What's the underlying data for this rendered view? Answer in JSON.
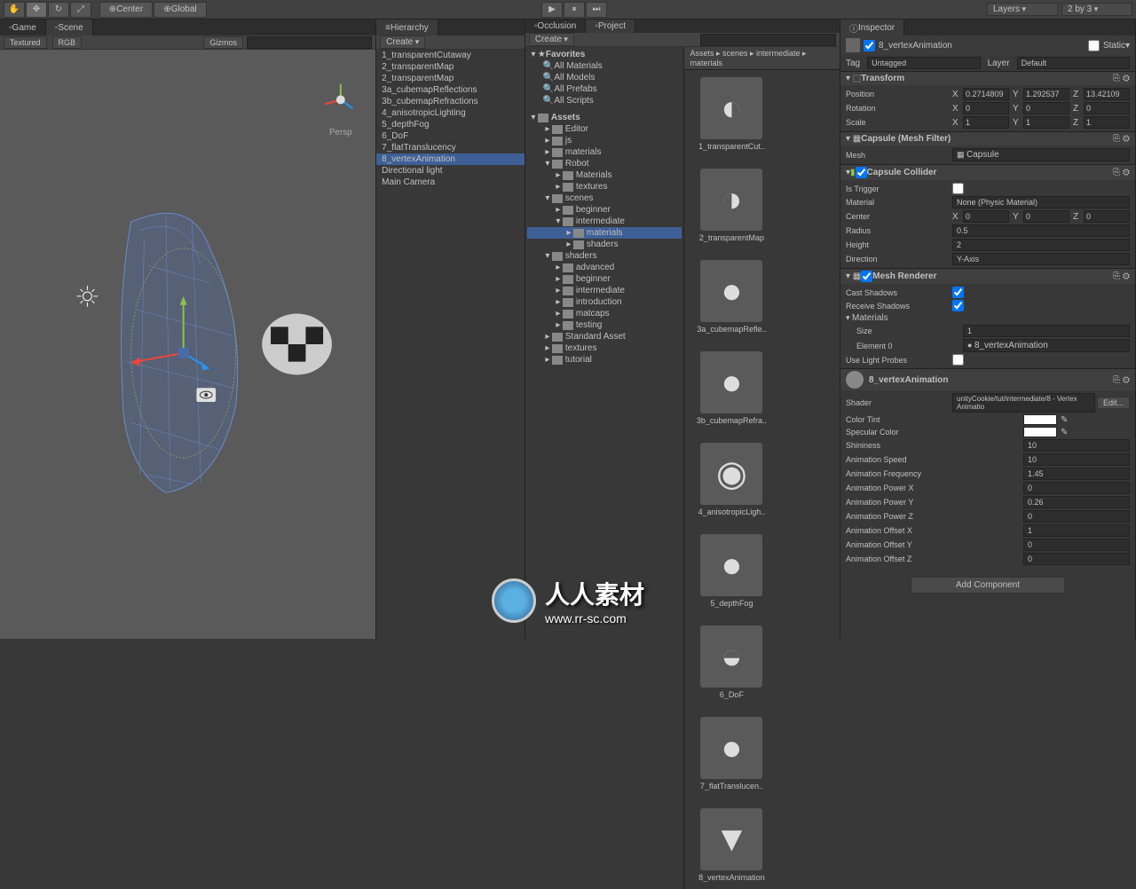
{
  "toolbar": {
    "center": "Center",
    "global": "Global",
    "layers": "Layers",
    "layout": "2 by 3"
  },
  "scene": {
    "tab_game": "Game",
    "tab_scene": "Scene",
    "mode": "Textured",
    "rgb": "RGB",
    "gizmos": "Gizmos",
    "persp": "Persp"
  },
  "hierarchy": {
    "title": "Hierarchy",
    "create": "Create",
    "items": [
      "1_transparentCutaway",
      "2_transparentMap",
      "2_transparentMap",
      "3a_cubemapReflections",
      "3b_cubemapRefractions",
      "4_anisotropicLighting",
      "5_depthFog",
      "6_DoF",
      "7_flatTranslucency",
      "8_vertexAnimation",
      "Directional light",
      "Main Camera"
    ],
    "selected_index": 9
  },
  "project": {
    "tab_occlusion": "Occlusion",
    "tab_project": "Project",
    "create": "Create",
    "favorites": {
      "label": "Favorites",
      "items": [
        "All Materials",
        "All Models",
        "All Prefabs",
        "All Scripts"
      ]
    },
    "assets": {
      "label": "Assets",
      "tree": [
        {
          "name": "Editor",
          "depth": 1
        },
        {
          "name": "js",
          "depth": 1
        },
        {
          "name": "materials",
          "depth": 1
        },
        {
          "name": "Robot",
          "depth": 1,
          "open": true
        },
        {
          "name": "Materials",
          "depth": 2
        },
        {
          "name": "textures",
          "depth": 2
        },
        {
          "name": "scenes",
          "depth": 1,
          "open": true
        },
        {
          "name": "beginner",
          "depth": 2
        },
        {
          "name": "intermediate",
          "depth": 2,
          "open": true
        },
        {
          "name": "materials",
          "depth": 3,
          "selected": true
        },
        {
          "name": "shaders",
          "depth": 3
        },
        {
          "name": "shaders",
          "depth": 1,
          "open": true
        },
        {
          "name": "advanced",
          "depth": 2
        },
        {
          "name": "beginner",
          "depth": 2
        },
        {
          "name": "intermediate",
          "depth": 2
        },
        {
          "name": "introduction",
          "depth": 2
        },
        {
          "name": "matcaps",
          "depth": 2
        },
        {
          "name": "testing",
          "depth": 2
        },
        {
          "name": "Standard Asset",
          "depth": 1
        },
        {
          "name": "textures",
          "depth": 1
        },
        {
          "name": "tutorial",
          "depth": 1
        }
      ]
    },
    "breadcrumb": [
      "Assets",
      "scenes",
      "intermediate",
      "materials"
    ],
    "grid": [
      "1_transparentCut..",
      "2_transparentMap",
      "3a_cubemapRefle..",
      "3b_cubemapRefra..",
      "4_anisotropicLigh..",
      "5_depthFog",
      "6_DoF",
      "7_flatTranslucen..",
      "8_vertexAnimation"
    ]
  },
  "inspector": {
    "title": "Inspector",
    "object_name": "8_vertexAnimation",
    "static": "Static",
    "tag_label": "Tag",
    "tag_value": "Untagged",
    "layer_label": "Layer",
    "layer_value": "Default",
    "transform": {
      "title": "Transform",
      "position": {
        "label": "Position",
        "x": "0.2714809",
        "y": "1.292537",
        "z": "13.42109"
      },
      "rotation": {
        "label": "Rotation",
        "x": "0",
        "y": "0",
        "z": "0"
      },
      "scale": {
        "label": "Scale",
        "x": "1",
        "y": "1",
        "z": "1"
      }
    },
    "mesh_filter": {
      "title": "Capsule (Mesh Filter)",
      "mesh_label": "Mesh",
      "mesh_value": "Capsule"
    },
    "collider": {
      "title": "Capsule Collider",
      "is_trigger": "Is Trigger",
      "material_label": "Material",
      "material_value": "None (Physic Material)",
      "center": {
        "label": "Center",
        "x": "0",
        "y": "0",
        "z": "0"
      },
      "radius_label": "Radius",
      "radius_value": "0.5",
      "height_label": "Height",
      "height_value": "2",
      "direction_label": "Direction",
      "direction_value": "Y-Axis"
    },
    "renderer": {
      "title": "Mesh Renderer",
      "cast_shadows": "Cast Shadows",
      "receive_shadows": "Receive Shadows",
      "materials": "Materials",
      "size_label": "Size",
      "size_value": "1",
      "element_label": "Element 0",
      "element_value": "8_vertexAnimation",
      "use_light_probes": "Use Light Probes"
    },
    "material": {
      "name": "8_vertexAnimation",
      "shader_label": "Shader",
      "shader_value": "unityCookie/tut/intermediate/8 - Vertex Animatio",
      "edit": "Edit...",
      "props": [
        {
          "label": "Color Tint",
          "type": "color",
          "value": "#ffffff"
        },
        {
          "label": "Specular Color",
          "type": "color",
          "value": "#ffffff"
        },
        {
          "label": "Shininess",
          "type": "num",
          "value": "10"
        },
        {
          "label": "Animation Speed",
          "type": "num",
          "value": "10"
        },
        {
          "label": "Animation Frequency",
          "type": "num",
          "value": "1.45"
        },
        {
          "label": "Animation Power X",
          "type": "num",
          "value": "0"
        },
        {
          "label": "Animation Power Y",
          "type": "num",
          "value": "0.26"
        },
        {
          "label": "Animation Power Z",
          "type": "num",
          "value": "0"
        },
        {
          "label": "Animation Offset X",
          "type": "num",
          "value": "1"
        },
        {
          "label": "Animation Offset Y",
          "type": "num",
          "value": "0"
        },
        {
          "label": "Animation Offset Z",
          "type": "num",
          "value": "0"
        }
      ]
    },
    "add_component": "Add Component"
  },
  "watermark": {
    "text": "人人素材",
    "url": "www.rr-sc.com"
  }
}
